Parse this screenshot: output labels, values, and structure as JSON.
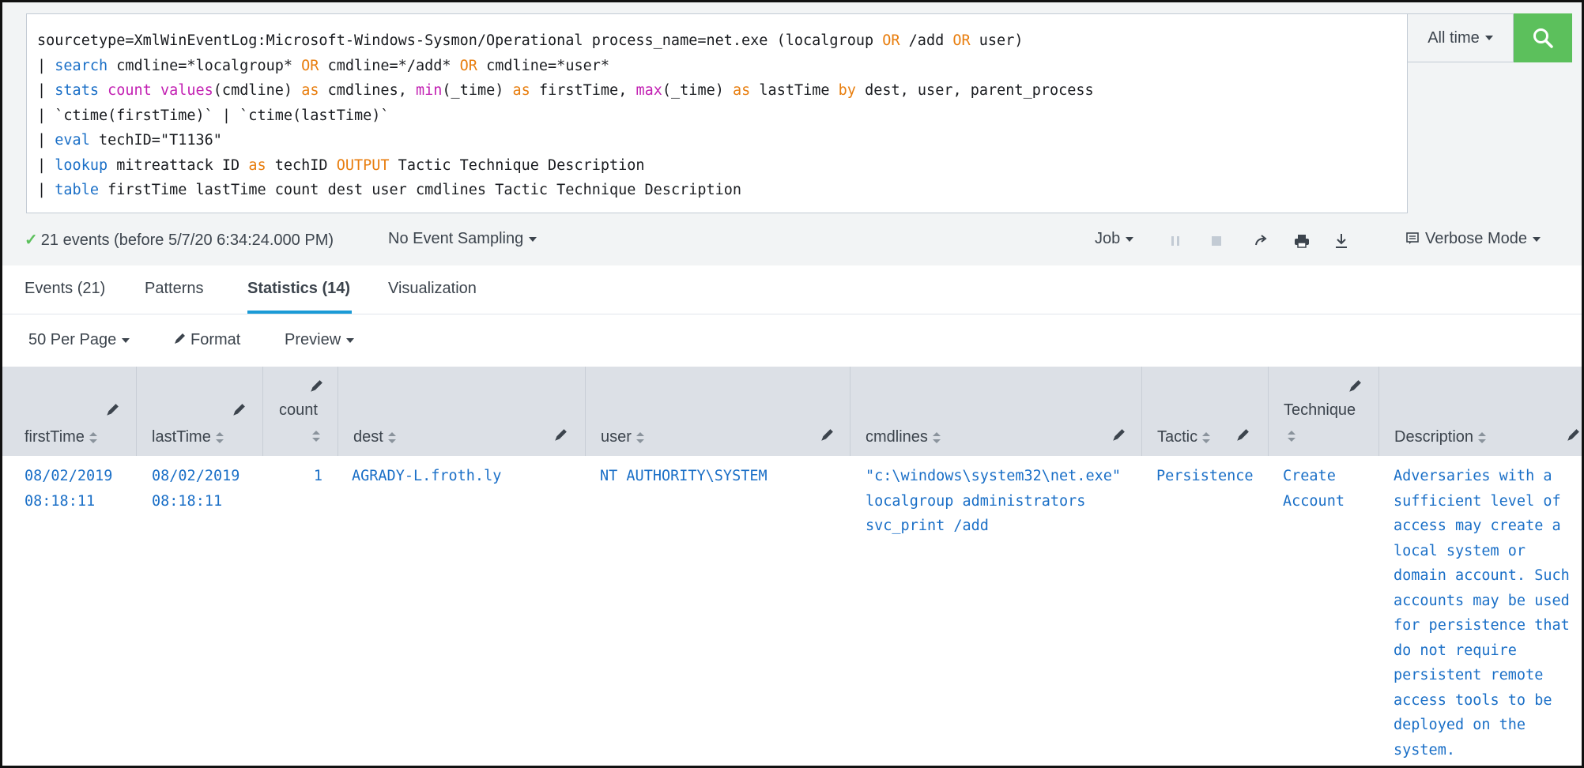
{
  "search": {
    "query_lines": [
      [
        {
          "t": "sourcetype=XmlWinEventLog:Microsoft-Windows-Sysmon/Operational process_name=net.exe (localgroup ",
          "c": ""
        },
        {
          "t": "OR",
          "c": "kw-orange"
        },
        {
          "t": " /add ",
          "c": ""
        },
        {
          "t": "OR",
          "c": "kw-orange"
        },
        {
          "t": " user)",
          "c": ""
        }
      ],
      [
        {
          "t": "| ",
          "c": ""
        },
        {
          "t": "search",
          "c": "kw-blue"
        },
        {
          "t": " cmdline=*localgroup* ",
          "c": ""
        },
        {
          "t": "OR",
          "c": "kw-orange"
        },
        {
          "t": " cmdline=*/add* ",
          "c": ""
        },
        {
          "t": "OR",
          "c": "kw-orange"
        },
        {
          "t": " cmdline=*user*",
          "c": ""
        }
      ],
      [
        {
          "t": "| ",
          "c": ""
        },
        {
          "t": "stats",
          "c": "kw-blue"
        },
        {
          "t": " ",
          "c": ""
        },
        {
          "t": "count",
          "c": "kw-pink"
        },
        {
          "t": " ",
          "c": ""
        },
        {
          "t": "values",
          "c": "kw-pink"
        },
        {
          "t": "(cmdline) ",
          "c": ""
        },
        {
          "t": "as",
          "c": "kw-orange"
        },
        {
          "t": " cmdlines, ",
          "c": ""
        },
        {
          "t": "min",
          "c": "kw-pink"
        },
        {
          "t": "(_time) ",
          "c": ""
        },
        {
          "t": "as",
          "c": "kw-orange"
        },
        {
          "t": " firstTime, ",
          "c": ""
        },
        {
          "t": "max",
          "c": "kw-pink"
        },
        {
          "t": "(_time) ",
          "c": ""
        },
        {
          "t": "as",
          "c": "kw-orange"
        },
        {
          "t": " lastTime ",
          "c": ""
        },
        {
          "t": "by",
          "c": "kw-orange"
        },
        {
          "t": " dest, user, parent_process",
          "c": ""
        }
      ],
      [
        {
          "t": "| `ctime(firstTime)` | `ctime(lastTime)`",
          "c": ""
        }
      ],
      [
        {
          "t": "| ",
          "c": ""
        },
        {
          "t": "eval",
          "c": "kw-blue"
        },
        {
          "t": " techID=\"T1136\"",
          "c": ""
        }
      ],
      [
        {
          "t": "| ",
          "c": ""
        },
        {
          "t": "lookup",
          "c": "kw-blue"
        },
        {
          "t": " mitreattack ID ",
          "c": ""
        },
        {
          "t": "as",
          "c": "kw-orange"
        },
        {
          "t": " techID ",
          "c": ""
        },
        {
          "t": "OUTPUT",
          "c": "kw-orange"
        },
        {
          "t": " Tactic Technique Description",
          "c": ""
        }
      ],
      [
        {
          "t": "| ",
          "c": ""
        },
        {
          "t": "table",
          "c": "kw-blue"
        },
        {
          "t": " firstTime lastTime count dest user cmdlines Tactic Technique Description",
          "c": ""
        }
      ]
    ],
    "time_range": "All time"
  },
  "job": {
    "status": "21 events (before 5/7/20 6:34:24.000 PM)",
    "sampling": "No Event Sampling",
    "job_label": "Job",
    "mode": "Verbose Mode"
  },
  "tabs": {
    "events": "Events (21)",
    "patterns": "Patterns",
    "statistics": "Statistics (14)",
    "visualization": "Visualization"
  },
  "controls": {
    "per_page": "50 Per Page",
    "format": "Format",
    "preview": "Preview"
  },
  "columns": {
    "firstTime": "firstTime",
    "lastTime": "lastTime",
    "count": "count",
    "dest": "dest",
    "user": "user",
    "cmdlines": "cmdlines",
    "tactic": "Tactic",
    "technique": "Technique",
    "description": "Description"
  },
  "row": {
    "firstTime_date": "08/02/2019",
    "firstTime_time": "08:18:11",
    "lastTime_date": "08/02/2019",
    "lastTime_time": "08:18:11",
    "count": "1",
    "dest": "AGRADY-L.froth.ly",
    "user": "NT AUTHORITY\\SYSTEM",
    "cmdlines": [
      "\"c:\\windows\\system32\\net.exe\"",
      "localgroup administrators",
      "svc_print /add"
    ],
    "tactic": "Persistence",
    "technique": [
      "Create",
      "Account"
    ],
    "description": [
      "Adversaries with a",
      "sufficient level of",
      "access may create a",
      "local system or",
      "domain account. Such",
      "accounts may be used",
      "for persistence that",
      "do not require",
      "persistent remote",
      "access tools to be",
      "deployed on the",
      "system."
    ]
  },
  "colors": {
    "accent_green": "#5cc05c",
    "link_blue": "#1a6fc7",
    "tab_underline": "#1a9ad6"
  }
}
